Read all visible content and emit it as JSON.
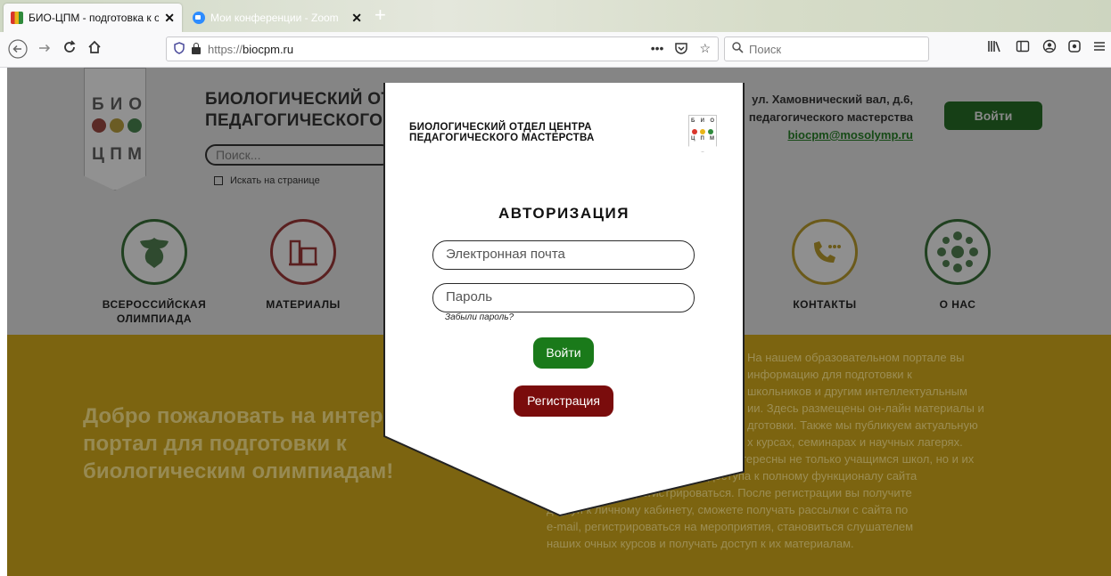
{
  "browser": {
    "tabs": [
      {
        "title": "БИО-ЦПМ - подготовка к оли",
        "close": "✕"
      },
      {
        "title": "Мои конференции - Zoom",
        "close": "✕"
      }
    ],
    "new_tab": "+",
    "url_proto": "https://",
    "url_host": "biocpm.ru",
    "url_more": "•••",
    "search_placeholder": "Поиск"
  },
  "site": {
    "logo_row1": [
      "Б",
      "И",
      "О"
    ],
    "logo_row2": [
      "Ц",
      "П",
      "М"
    ],
    "title_line1": "БИОЛОГИЧЕСКИЙ ОТДЕЛ",
    "title_line2": "ПЕДАГОГИЧЕСКОГО МАСТЕРСТВА",
    "search_placeholder": "Поиск...",
    "search_in_page": "Искать на странице",
    "address_line1": "ул. Хамовнический вал, д.6,",
    "address_line2": "педагогического мастерства",
    "email": "biocpm@mosolymp.ru",
    "login_button": "Войти"
  },
  "nav": [
    {
      "label_line1": "ВСЕРОССИЙСКАЯ",
      "label_line2": "ОЛИМПИАДА"
    },
    {
      "label_line1": "МАТЕРИАЛЫ",
      "label_line2": ""
    },
    {
      "label_line1": "КОНТАКТЫ",
      "label_line2": ""
    },
    {
      "label_line1": "О НАС",
      "label_line2": ""
    }
  ],
  "hero": {
    "title": "Добро пожаловать на интернет-портал для подготовки к биологическим олимпиадам!",
    "text_lines": [
      "На нашем образовательном портале вы",
      "информацию для подготовки к",
      "школьников и другим интеллектуальным",
      "ии. Здесь размещены он-лайн материалы и",
      "дготовки. Также мы публикуем актуальную",
      "х курсах, семинарах и научных лагерях.",
      "дут интересны не только учащимся школ, но и их",
      "учителям. Для доступа к полному функционалу сайта",
      "Вас зарегистрироваться. После регистрации вы получите",
      "доступ к личному кабинету, сможете получать рассылки с сайта по",
      "e-mail, регистрироваться на мероприятия, становиться слушателем",
      "наших очных курсов и получать доступ к их материалам."
    ]
  },
  "modal": {
    "org_line1": "БИОЛОГИЧЕСКИЙ ОТДЕЛ ЦЕНТРА",
    "org_line2": "ПЕДАГОГИЧЕСКОГО МАСТЕРСТВА",
    "heading": "АВТОРИЗАЦИЯ",
    "email_placeholder": "Электронная почта",
    "password_placeholder": "Пароль",
    "forgot": "Забыли пароль?",
    "login_button": "Войти",
    "register_button": "Регистрация"
  },
  "colors": {
    "hero_bg": "#7c6410",
    "login_green": "#1a7a1a",
    "register_red": "#7a0c0c",
    "dot_red": "#d9352b",
    "dot_yellow": "#e8b418",
    "dot_green": "#2f8a3c"
  },
  "icons": [
    "back-icon",
    "forward-icon",
    "reload-icon",
    "home-icon",
    "shield-icon",
    "lock-icon",
    "pocket-icon",
    "star-icon",
    "search-icon",
    "library-icon",
    "sidebar-icon",
    "account-icon",
    "extension-icon",
    "menu-icon",
    "eagle-icon",
    "books-icon",
    "phone-icon",
    "network-icon"
  ]
}
